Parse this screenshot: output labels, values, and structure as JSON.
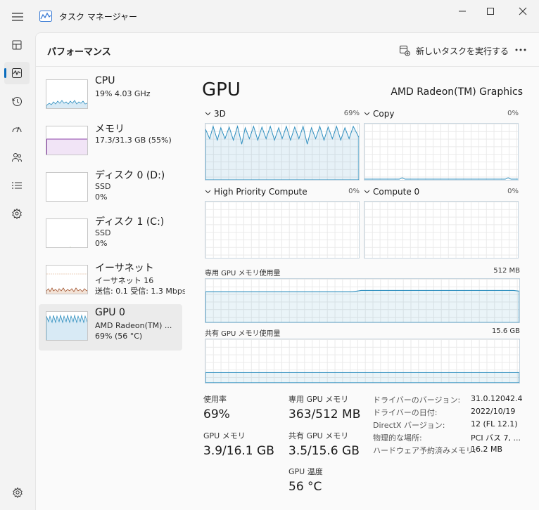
{
  "app": {
    "title": "タスク マネージャー"
  },
  "header": {
    "title": "パフォーマンス",
    "run_task_label": "新しいタスクを実行する"
  },
  "devices": [
    {
      "name": "CPU",
      "line1": "19%  4.03 GHz",
      "line2": ""
    },
    {
      "name": "メモリ",
      "line1": "17.3/31.3 GB (55%)",
      "line2": ""
    },
    {
      "name": "ディスク 0 (D:)",
      "line1": "SSD",
      "line2": "0%"
    },
    {
      "name": "ディスク 1 (C:)",
      "line1": "SSD",
      "line2": "0%"
    },
    {
      "name": "イーサネット",
      "line1": "イーサネット 16",
      "line2": "送信: 0.1  受信: 1.3 Mbps"
    },
    {
      "name": "GPU 0",
      "line1": "AMD Radeon(TM) ...",
      "line2": "69%  (56 °C)"
    }
  ],
  "gpu": {
    "title": "GPU",
    "model": "AMD Radeon(TM) Graphics",
    "engines": [
      {
        "name": "3D",
        "percent": "69%"
      },
      {
        "name": "Copy",
        "percent": "0%"
      },
      {
        "name": "High Priority Compute",
        "percent": "0%"
      },
      {
        "name": "Compute 0",
        "percent": "0%"
      }
    ],
    "dedicated_label": "専用 GPU メモリ使用量",
    "dedicated_max": "512 MB",
    "shared_label": "共有 GPU メモリ使用量",
    "shared_max": "15.6 GB"
  },
  "stats": {
    "utilization_label": "使用率",
    "utilization_value": "69%",
    "gpu_mem_label": "GPU メモリ",
    "gpu_mem_value": "3.9/16.1 GB",
    "dedicated_label": "専用 GPU メモリ",
    "dedicated_value": "363/512 MB",
    "shared_label": "共有 GPU メモリ",
    "shared_value": "3.5/15.6 GB",
    "temp_label": "GPU 温度",
    "temp_value": "56 °C"
  },
  "info": [
    {
      "key": "ドライバーのバージョン:",
      "value": "31.0.12042.4"
    },
    {
      "key": "ドライバーの日付:",
      "value": "2022/10/19"
    },
    {
      "key": "DirectX バージョン:",
      "value": "12 (FL 12.1)"
    },
    {
      "key": "物理的な場所:",
      "value": "PCI バス 7, ..."
    },
    {
      "key": "ハードウェア予約済みメモリ:",
      "value": "16.2 MB"
    }
  ],
  "colors": {
    "gpu": "#2f8fbf",
    "memory": "#8b3fa8",
    "ethernet": "#a0522d",
    "accent": "#0a6cbd"
  }
}
